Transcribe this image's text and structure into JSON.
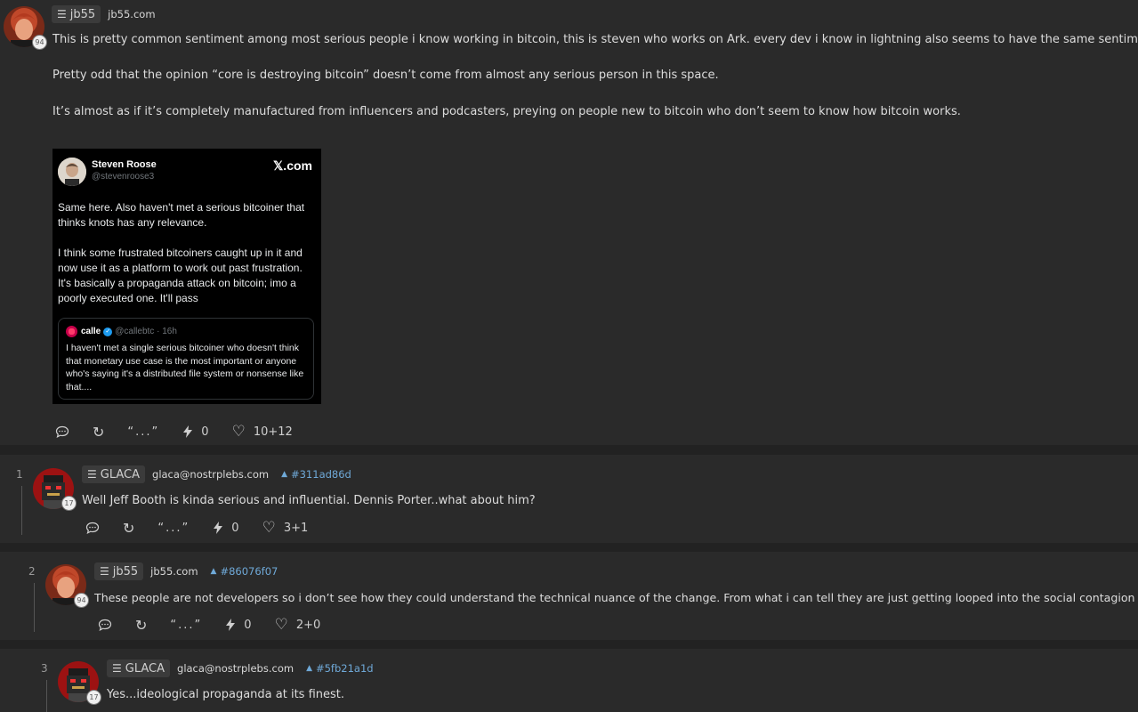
{
  "posts": [
    {
      "user": "jb55",
      "domain": "jb55.com",
      "badge": "94",
      "paragraphs": [
        "This is pretty common sentiment among most serious people i know working in bitcoin, this is steven who works on Ark. every dev i know in lightning also seems to have the same sentiment.",
        "Pretty odd that the opinion “core is destroying bitcoin” doesn’t come from almost any serious person in this space.",
        "It’s almost as if it’s completely manufactured from influencers and podcasters, preying on people new to bitcoin who don’t seem to know how bitcoin works."
      ],
      "embed": {
        "author_name": "Steven Roose",
        "author_handle": "@stevenroose3",
        "brand": "𝕏.com",
        "body_1": "Same here. Also haven't met a serious bitcoiner that thinks knots has any relevance.",
        "body_2": "I think some frustrated bitcoiners caught up in it and now use it as a platform to work out past frustration. It's basically a propaganda attack on bitcoin; imo a poorly executed one. It'll pass",
        "quote_name": "calle",
        "quote_meta": "@callebtc · 16h",
        "quote_body": "I haven't met a single serious bitcoiner who doesn't think that monetary use case is the most important or anyone who's saying it's a distributed file system or nonsense like that...."
      },
      "actions": {
        "quote": "“...”",
        "zaps": "0",
        "likes": "10+12"
      }
    },
    {
      "number": "1",
      "user": "GLACA",
      "domain": "glaca@nostrplebs.com",
      "badge": "17",
      "hash": "#311ad86d",
      "text": "Well Jeff Booth is kinda serious and influential. Dennis Porter..what about him?",
      "actions": {
        "quote": "“...”",
        "zaps": "0",
        "likes": "3+1"
      }
    },
    {
      "number": "2",
      "user": "jb55",
      "domain": "jb55.com",
      "badge": "94",
      "hash": "#86076f07",
      "text": "These people are not developers so i don’t see how they could understand the technical nuance of the change. From what i can tell they are just getting looped into the social contagion",
      "actions": {
        "quote": "“...”",
        "zaps": "0",
        "likes": "2+0"
      }
    },
    {
      "number": "3",
      "user": "GLACA",
      "domain": "glaca@nostrplebs.com",
      "badge": "17",
      "hash": "#5fb21a1d",
      "text": "Yes...ideological propaganda at its finest."
    }
  ],
  "icons": {
    "menu": "☰",
    "hash_arrow": "▲",
    "reply": "comment-bubble-icon",
    "repost": "↻",
    "zap": "⚡",
    "like": "♡"
  },
  "colors": {
    "background": "#222222",
    "panel": "#2a2a2a",
    "link": "#6fa9d8",
    "text": "#dcdcdc"
  }
}
